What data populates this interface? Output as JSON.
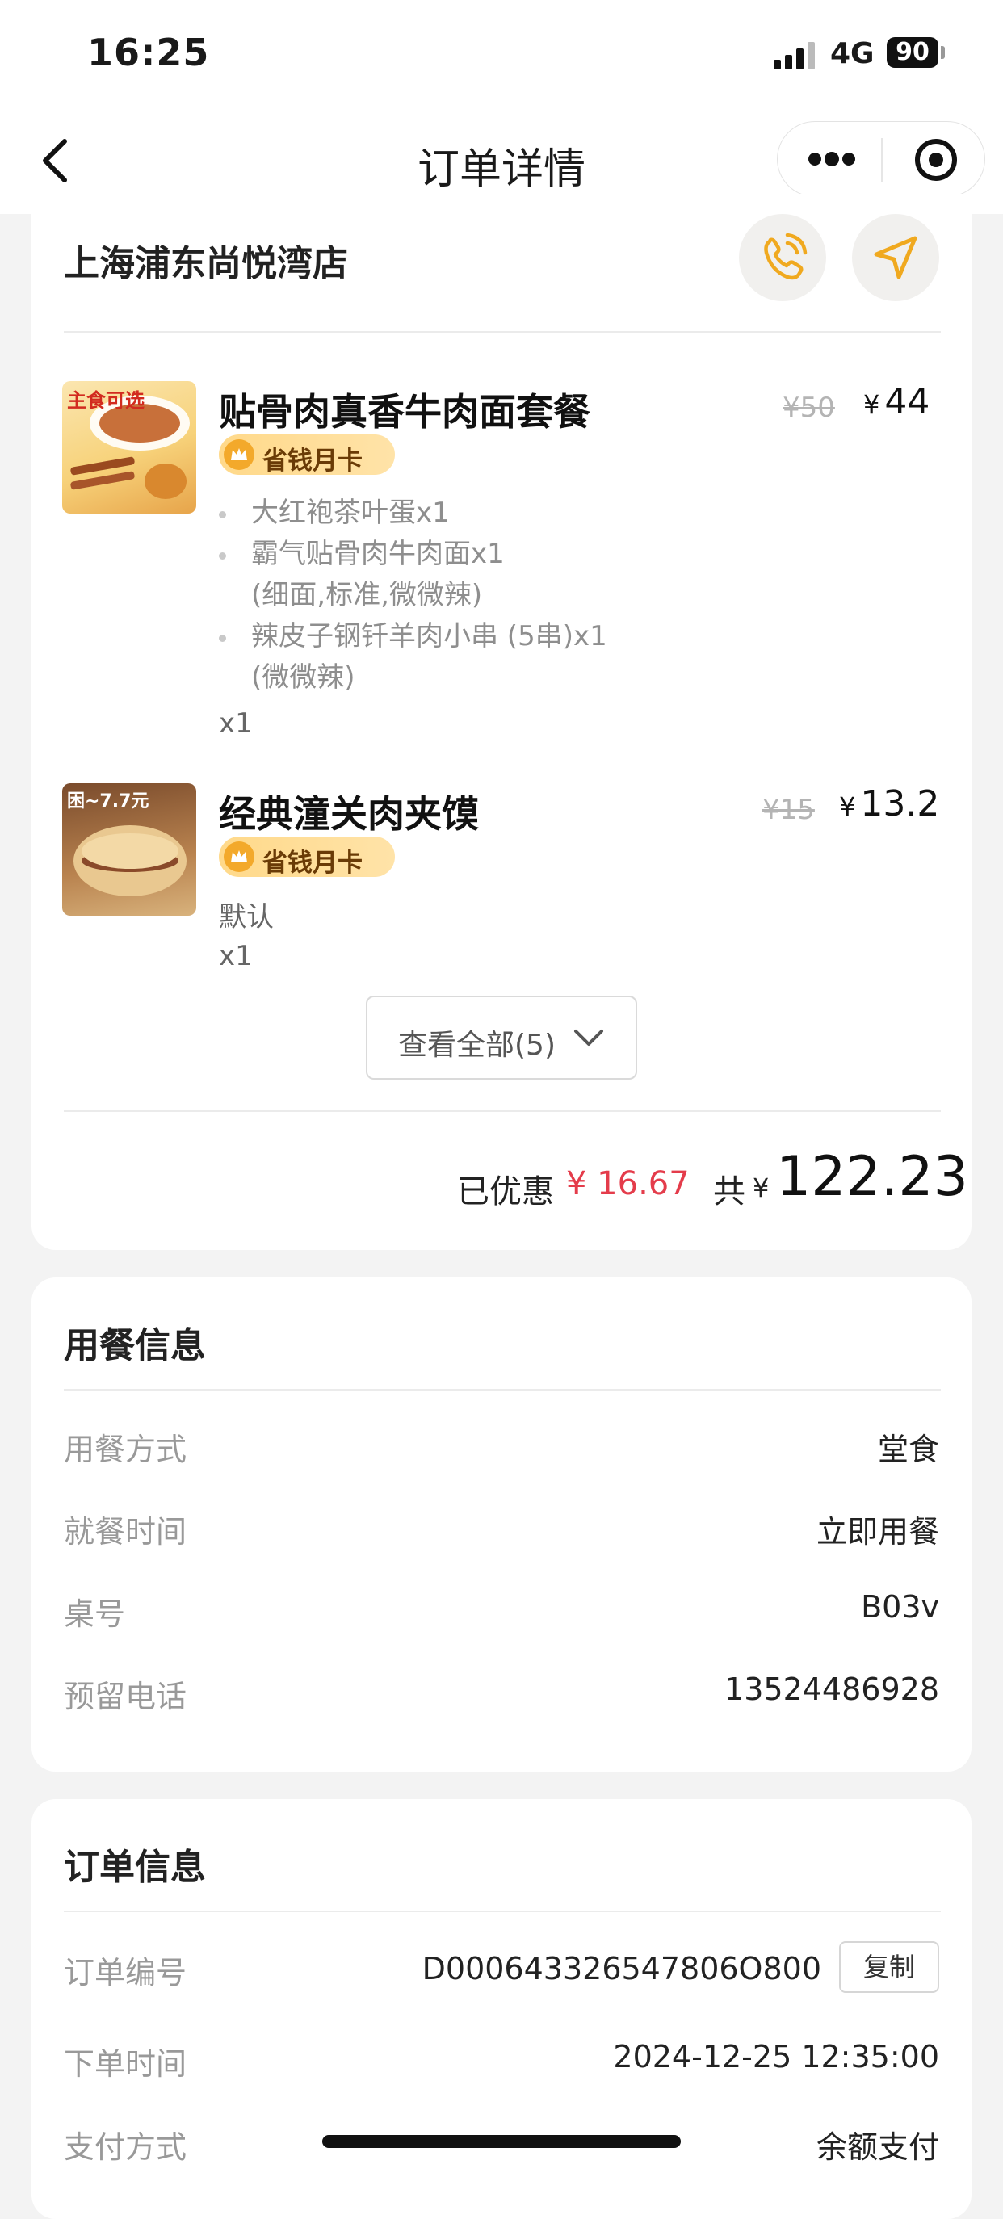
{
  "status_bar": {
    "time": "16:25",
    "network": "4G",
    "battery": "90"
  },
  "nav": {
    "title": "订单详情"
  },
  "store": {
    "name": "上海浦东尚悦湾店"
  },
  "items": [
    {
      "name": "贴骨肉真香牛肉面套餐",
      "badge": "省钱月卡",
      "original_price": "¥50",
      "currency": "¥",
      "price": "44",
      "thumb_text": "主食可选",
      "sub_items": [
        {
          "text": "大红袍茶叶蛋x1"
        },
        {
          "text": "霸气贴骨肉牛肉面x1",
          "note": "(细面,标准,微微辣)"
        },
        {
          "text": "辣皮子钢钎羊肉小串 (5串)x1",
          "note": "(微微辣)"
        }
      ],
      "qty": "x1"
    },
    {
      "name": "经典潼关肉夹馍",
      "badge": "省钱月卡",
      "original_price": "¥15",
      "currency": "¥",
      "price": "13.2",
      "thumb_text": "困~7.7元",
      "spec": "默认",
      "qty": "x1"
    }
  ],
  "view_all": "查看全部(5)",
  "summary": {
    "discount_label": "已优惠",
    "discount_value": "¥ 16.67",
    "total_label": "共",
    "total_currency": "¥",
    "total_value": "122.23"
  },
  "dining_info": {
    "title": "用餐信息",
    "rows": [
      {
        "label": "用餐方式",
        "value": "堂食"
      },
      {
        "label": "就餐时间",
        "value": "立即用餐"
      },
      {
        "label": "桌号",
        "value": "B03v"
      },
      {
        "label": "预留电话",
        "value": "13524486928"
      }
    ]
  },
  "order_info": {
    "title": "订单信息",
    "copy_label": "复制",
    "rows": [
      {
        "label": "订单编号",
        "value": "D000643326547806O800"
      },
      {
        "label": "下单时间",
        "value": "2024-12-25 12:35:00"
      },
      {
        "label": "支付方式",
        "value": "余额支付"
      }
    ]
  },
  "colors": {
    "accent_yellow": "#f3a92b",
    "discount_red": "#e43c4b",
    "badge_bg": "#ffd98a"
  }
}
